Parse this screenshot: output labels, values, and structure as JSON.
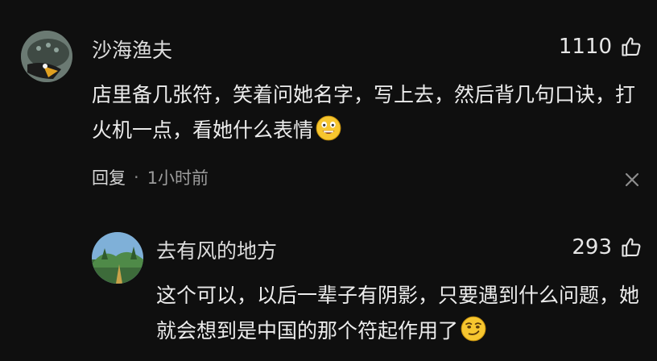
{
  "comment": {
    "username": "沙海渔夫",
    "likes": "1110",
    "text": "店里备几张符，笑着问她名字，写上去，然后背几句口诀，打火机一点，看她什么表情",
    "reply_label": "回复",
    "separator": "·",
    "time": "1小时前"
  },
  "reply": {
    "username": "去有风的地方",
    "likes": "293",
    "text": "这个可以，以后一辈子有阴影，只要遇到什么问题，她就会想到是中国的那个符起作用了"
  },
  "icons": {
    "like": "thumbs-up-icon",
    "close": "close-icon",
    "emoji1": "grinning-emoji",
    "emoji2": "smirk-emoji"
  },
  "colors": {
    "background": "#0f0f0f",
    "text": "#ececec",
    "muted": "#9c9c9c"
  }
}
